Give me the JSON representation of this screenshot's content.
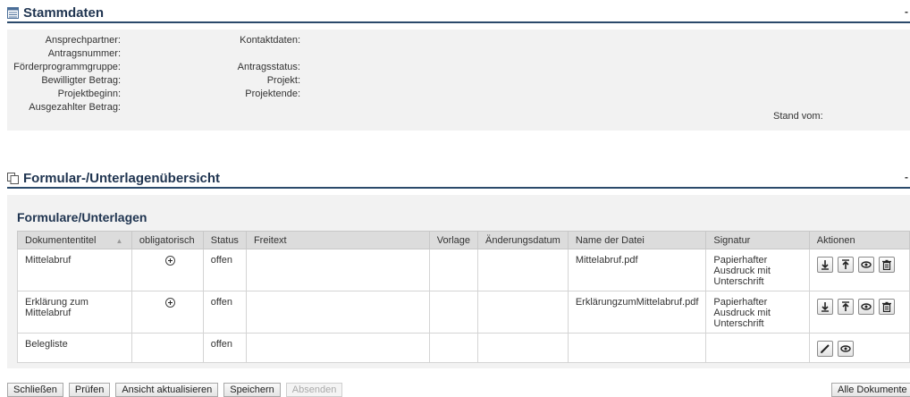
{
  "stammdaten": {
    "title": "Stammdaten",
    "collapse": "-",
    "labels_left": {
      "ansprechpartner": "Ansprechpartner:",
      "antragsnummer": "Antragsnummer:",
      "foerderprogrammgruppe": "Förderprogrammgruppe:",
      "bewilligter_betrag": "Bewilligter Betrag:",
      "projektbeginn": "Projektbeginn:",
      "ausgezahlter_betrag": "Ausgezahlter Betrag:"
    },
    "labels_mid": {
      "kontaktdaten": "Kontaktdaten:",
      "antragsstatus": "Antragsstatus:",
      "projekt": "Projekt:",
      "projektende": "Projektende:"
    },
    "stand_vom": "Stand vom:"
  },
  "uebersicht": {
    "title": "Formular-/Unterlagenübersicht",
    "collapse": "-",
    "subtitle": "Formulare/Unterlagen",
    "columns": [
      "Dokumententitel",
      "obligatorisch",
      "Status",
      "Freitext",
      "Vorlage",
      "Änderungsdatum",
      "Name der Datei",
      "Signatur",
      "Aktionen"
    ],
    "sort_indicator": "▲",
    "rows": [
      {
        "titel": "Mittelabruf",
        "obligatorisch": "plus-icon",
        "status": "offen",
        "freitext": "",
        "vorlage": "",
        "aenderungsdatum": "",
        "datei": "Mittelabruf.pdf",
        "signatur": "Papierhafter Ausdruck mit Unterschrift",
        "aktionen": [
          "download-icon",
          "upload-icon",
          "view-icon",
          "delete-icon"
        ]
      },
      {
        "titel": "Erklärung zum Mittelabruf",
        "obligatorisch": "plus-icon",
        "status": "offen",
        "freitext": "",
        "vorlage": "",
        "aenderungsdatum": "",
        "datei": "ErklärungzumMittelabruf.pdf",
        "signatur": "Papierhafter Ausdruck mit Unterschrift",
        "aktionen": [
          "download-icon",
          "upload-icon",
          "view-icon",
          "delete-icon"
        ]
      },
      {
        "titel": "Belegliste",
        "obligatorisch": "",
        "status": "offen",
        "freitext": "",
        "vorlage": "",
        "aenderungsdatum": "",
        "datei": "",
        "signatur": "",
        "aktionen": [
          "edit-icon",
          "view-icon"
        ]
      }
    ]
  },
  "buttons": {
    "schliessen": "Schließen",
    "pruefen": "Prüfen",
    "ansicht": "Ansicht aktualisieren",
    "speichern": "Speichern",
    "absenden": "Absenden",
    "alle_loeschen": "Alle Dokumente löschen"
  },
  "colors": {
    "accent": "#1f3450",
    "rule": "#2b4a6b",
    "panel": "#f2f2f2",
    "header": "#dcdcdc"
  }
}
